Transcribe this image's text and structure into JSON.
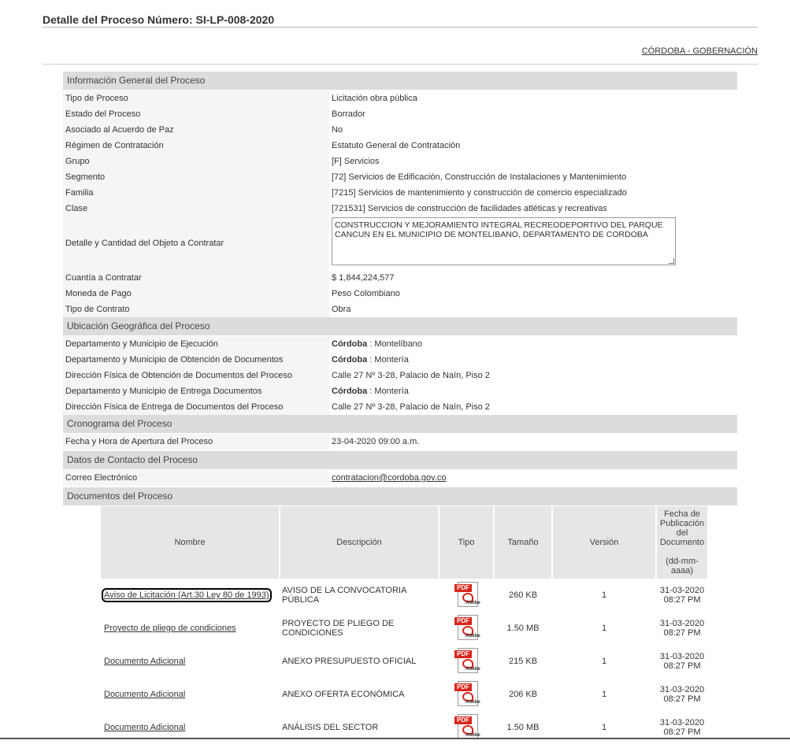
{
  "page": {
    "title": "Detalle del Proceso Número: SI-LP-008-2020",
    "entity": "CÓRDOBA - GOBERNACIÓN"
  },
  "general": {
    "header": "Información General del Proceso",
    "rows": [
      {
        "label": "Tipo de Proceso",
        "value": "Licitación obra pública"
      },
      {
        "label": "Estado del Proceso",
        "value": "Borrador"
      },
      {
        "label": "Asociado al Acuerdo de Paz",
        "value": "No"
      },
      {
        "label": "Régimen de Contratación",
        "value": "Estatuto General de Contratación"
      },
      {
        "label": "Grupo",
        "value": "[F] Servicios"
      },
      {
        "label": "Segmento",
        "value": "[72] Servicios de Edificación, Construcción de Instalaciones y Mantenimiento"
      },
      {
        "label": "Familia",
        "value": "[7215] Servicios de mantenimiento y construcción de comercio especializado"
      },
      {
        "label": "Clase",
        "value": "[721531] Servicios de construcción de facilidades atléticas y recreativas"
      }
    ],
    "objeto_label": "Detalle y Cantidad del Objeto a Contratar",
    "objeto_value": "CONSTRUCCION Y MEJORAMIENTO INTEGRAL RECREODEPORTIVO DEL PARQUE CANCUN EN EL MUNICIPIO DE MONTELIBANO, DEPARTAMENTO DE CORDOBA",
    "rows2": [
      {
        "label": "Cuantía a Contratar",
        "value": "$ 1,844,224,577"
      },
      {
        "label": "Moneda de Pago",
        "value": "Peso Colombiano"
      },
      {
        "label": "Tipo de Contrato",
        "value": "Obra"
      }
    ]
  },
  "ubicacion": {
    "header": "Ubicación Geográfica del Proceso",
    "rows": [
      {
        "label": "Departamento y Municipio de Ejecución",
        "bold": "Córdoba",
        "value": " : Montelíbano"
      },
      {
        "label": "Departamento y Municipio de Obtención de Documentos",
        "bold": "Córdoba",
        "value": " : Montería"
      },
      {
        "label": "Dirección Física de Obtención de Documentos del Proceso",
        "bold": "",
        "value": "Calle 27 Nº 3-28, Palacio de Naín, Piso 2"
      },
      {
        "label": "Departamento y Municipio de Entrega Documentos",
        "bold": "Córdoba",
        "value": " : Montería"
      },
      {
        "label": "Dirección Física de Entrega de Documentos del Proceso",
        "bold": "",
        "value": "Calle 27 Nº 3-28, Palacio de Naín, Piso 2"
      }
    ]
  },
  "cronograma": {
    "header": "Cronograma del Proceso",
    "label": "Fecha y Hora de Apertura del Proceso",
    "value": "23-04-2020 09:00 a.m."
  },
  "contacto": {
    "header": "Datos de Contacto del Proceso",
    "label": "Correo Electrónico",
    "value": "contratacion@cordoba.gov.co"
  },
  "documentos": {
    "header": "Documentos del Proceso",
    "columns": {
      "nombre": "Nombre",
      "descripcion": "Descripción",
      "tipo": "Tipo",
      "tamano": "Tamaño",
      "version": "Versión",
      "fecha": "Fecha de Publicación del Documento",
      "fecha_fmt": "(dd-mm-aaaa)"
    },
    "pdf_tag": "PDF",
    "pdf_brand": "Adobe",
    "rows": [
      {
        "nombre": "Aviso de Licitación (Art.30 Ley 80 de 1993)",
        "descripcion": "AVISO DE LA CONVOCATORIA PÚBLICA",
        "tamano": "260 KB",
        "version": "1",
        "fecha": "31-03-2020",
        "hora": "08:27 PM"
      },
      {
        "nombre": "Proyecto de pliego de condiciones",
        "descripcion": "PROYECTO DE PLIEGO DE CONDICIONES",
        "tamano": "1.50 MB",
        "version": "1",
        "fecha": "31-03-2020",
        "hora": "08:27 PM"
      },
      {
        "nombre": "Documento Adicional",
        "descripcion": "ANEXO PRESUPUESTO OFICIAL",
        "tamano": "215 KB",
        "version": "1",
        "fecha": "31-03-2020",
        "hora": "08:27 PM"
      },
      {
        "nombre": "Documento Adicional",
        "descripcion": "ANEXO OFERTA ECONÓMICA",
        "tamano": "206 KB",
        "version": "1",
        "fecha": "31-03-2020",
        "hora": "08:27 PM"
      },
      {
        "nombre": "Documento Adicional",
        "descripcion": "ANÁLISIS DEL SECTOR",
        "tamano": "1.50 MB",
        "version": "1",
        "fecha": "31-03-2020",
        "hora": "08:27 PM"
      }
    ]
  }
}
